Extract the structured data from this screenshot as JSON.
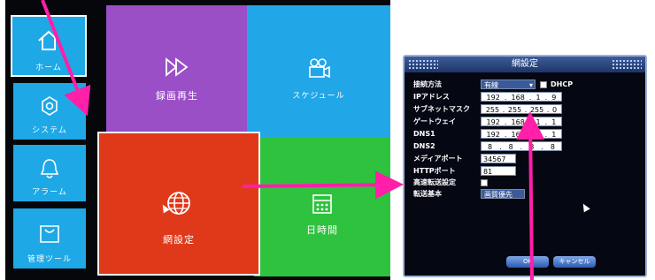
{
  "menu": {
    "home_label": "ホーム",
    "system_label": "システム",
    "alarm_label": "アラーム",
    "management_label": "管理ツール",
    "playback_label": "録画再生",
    "schedule_label": "スケジュール",
    "network_label": "網設定",
    "datetime_label": "日時間"
  },
  "colors": {
    "side_tile": "#1ea8e6",
    "playback": "#9a4fc6",
    "schedule": "#21a6e8",
    "network": "#e0391a",
    "datetime": "#2fc23f",
    "arrow": "#ff1fa8"
  },
  "icons": [
    "home-icon",
    "gear-icon",
    "bell-icon",
    "bag-icon",
    "fast-forward-icon",
    "camera-icon",
    "globe-icon",
    "calendar-icon"
  ],
  "dialog": {
    "title": "網設定",
    "connection_label": "接続方法",
    "connection_value": "有線",
    "dhcp_label": "DHCP",
    "ip_label": "IPアドレス",
    "ip_value": [
      "192",
      "168",
      "1",
      "9"
    ],
    "subnet_label": "サブネットマスク",
    "subnet_value": [
      "255",
      "255",
      "255",
      "0"
    ],
    "gateway_label": "ゲートウェイ",
    "gateway_value": [
      "192",
      "168",
      "1",
      "1"
    ],
    "dns1_label": "DNS1",
    "dns1_value": [
      "192",
      "168",
      "1",
      "1"
    ],
    "dns2_label": "DNS2",
    "dns2_value": [
      "8",
      "8",
      "8",
      "8"
    ],
    "media_port_label": "メディアポート",
    "media_port_value": "34567",
    "http_port_label": "HTTPポート",
    "http_port_value": "81",
    "fast_transfer_label": "高速転送設定",
    "transfer_basis_label": "転送基本",
    "transfer_basis_value": "画質優先",
    "ok_label": "OK",
    "cancel_label": "キャンセル"
  }
}
